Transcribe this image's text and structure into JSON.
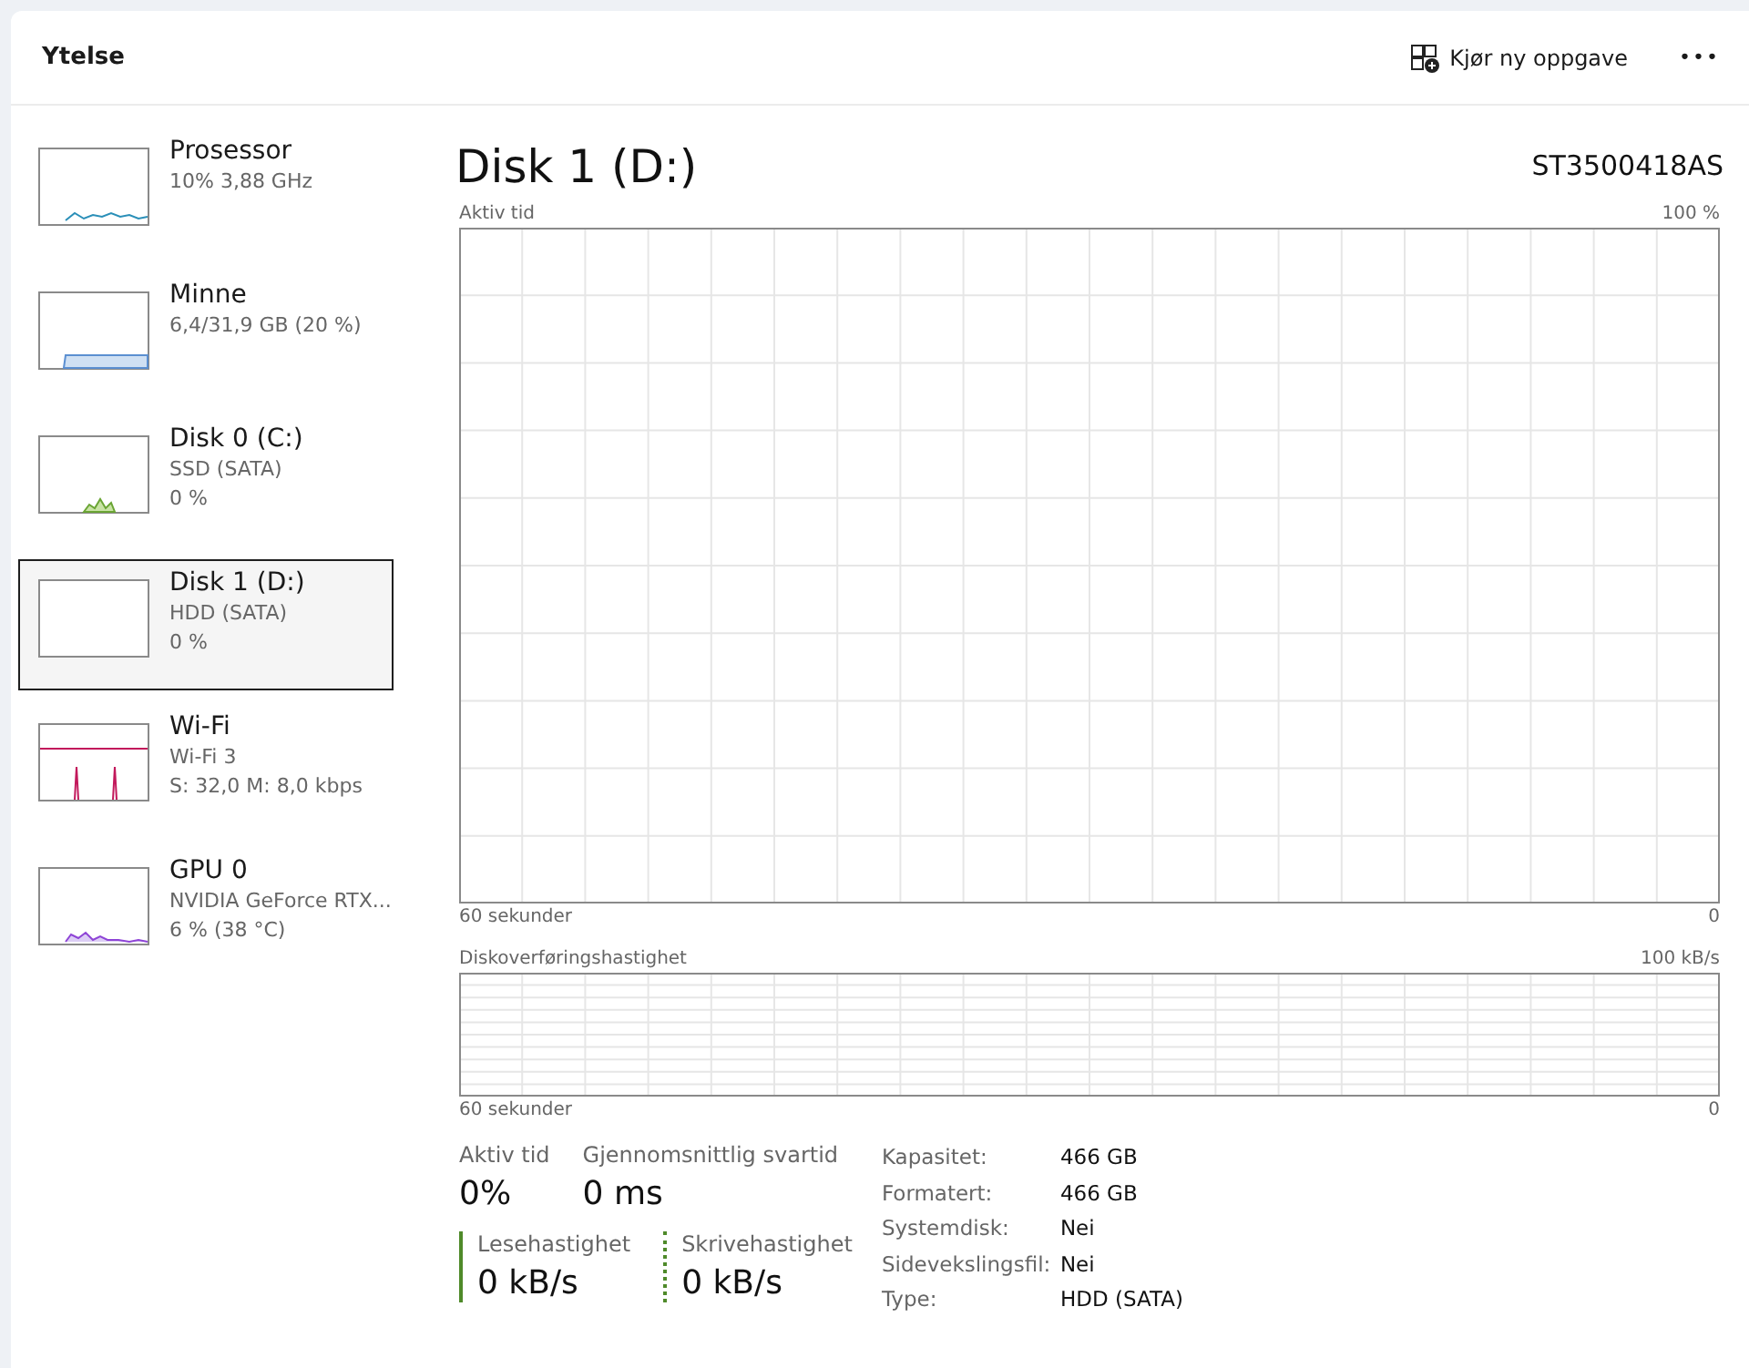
{
  "header": {
    "title": "Ytelse",
    "run_task": "Kjør ny oppgave",
    "more": "•••"
  },
  "sidebar": {
    "items": [
      {
        "kind": "cpu",
        "name": "Prosessor",
        "lines": [
          "10%  3,88 GHz"
        ],
        "selected": false
      },
      {
        "kind": "memory",
        "name": "Minne",
        "lines": [
          "6,4/31,9 GB (20 %)"
        ],
        "selected": false
      },
      {
        "kind": "disk-active",
        "name": "Disk 0 (C:)",
        "lines": [
          "SSD (SATA)",
          "0 %"
        ],
        "selected": false
      },
      {
        "kind": "disk-idle",
        "name": "Disk 1 (D:)",
        "lines": [
          "HDD (SATA)",
          "0 %"
        ],
        "selected": true
      },
      {
        "kind": "wifi",
        "name": "Wi-Fi",
        "lines": [
          "Wi-Fi 3",
          "S: 32,0 M: 8,0 kbps"
        ],
        "selected": false
      },
      {
        "kind": "gpu",
        "name": "GPU 0",
        "lines": [
          "NVIDIA GeForce RTX...",
          "6 % (38 °C)"
        ],
        "selected": false
      }
    ]
  },
  "main": {
    "title": "Disk 1 (D:)",
    "model": "ST3500418AS",
    "graphs": [
      {
        "kind": "tall",
        "label": "Aktiv tid",
        "max": "100 %",
        "time": "60 sekunder",
        "min": "0"
      },
      {
        "kind": "short",
        "label": "Diskoverføringshastighet",
        "max": "100 kB/s",
        "time": "60 sekunder",
        "min": "0"
      }
    ],
    "stats": [
      {
        "label": "Aktiv tid",
        "value": "0%"
      },
      {
        "label": "Gjennomsnittlig svartid",
        "value": "0 ms"
      }
    ],
    "rates": [
      {
        "kind": "solid",
        "label": "Lesehastighet",
        "value": "0 kB/s"
      },
      {
        "kind": "dashed",
        "label": "Skrivehastighet",
        "value": "0 kB/s"
      }
    ],
    "properties": [
      {
        "label": "Kapasitet:",
        "value": "466 GB"
      },
      {
        "label": "Formatert:",
        "value": "466 GB"
      },
      {
        "label": "Systemdisk:",
        "value": "Nei"
      },
      {
        "label": "Sidevekslingsfil:",
        "value": "Nei"
      },
      {
        "label": "Type:",
        "value": "HDD (SATA)"
      }
    ]
  }
}
